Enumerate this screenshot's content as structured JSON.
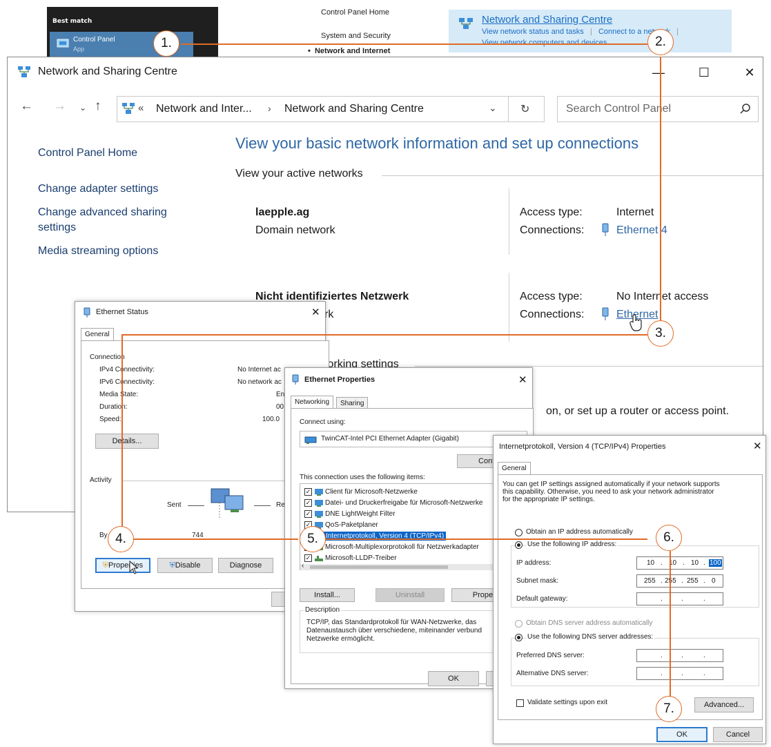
{
  "start_menu": {
    "best_match": "Best match",
    "item_label": "Control Panel",
    "item_sub": "App"
  },
  "cp_top": {
    "home": "Control Panel Home",
    "system": "System and Security",
    "network": "Network and Internet"
  },
  "nsc_top": {
    "title": "Network and Sharing Centre",
    "link1": "View network status and tasks",
    "link2": "Connect to a network",
    "link3": "View network computers and devices"
  },
  "main_window": {
    "title": "Network and Sharing Centre",
    "controls": {
      "minimize": "—",
      "maximize": "☐",
      "close": "✕"
    },
    "address": {
      "part1": "Network and Inter...",
      "separator": "›",
      "part2": "Network and Sharing Centre"
    },
    "search_placeholder": "Search Control Panel",
    "left_nav": [
      "Control Panel Home",
      "Change adapter settings",
      "Change advanced sharing",
      "settings",
      "Media streaming options"
    ],
    "headline": "View your basic network information and set up connections",
    "active_networks": "View your active networks",
    "network1": {
      "name": "laepple.ag",
      "type": "Domain network",
      "access_label": "Access type:",
      "access_value": "Internet",
      "conn_label": "Connections:",
      "conn_value": "Ethernet 4"
    },
    "network2": {
      "name": "Nicht identifiziertes Netzwerk",
      "type_partial": "rk",
      "access_label": "Access type:",
      "access_value": "No Internet access",
      "conn_label": "Connections:",
      "conn_value": "Ethernet"
    },
    "change_partial": "working settings",
    "router_partial": "on, or set up a router or access point."
  },
  "ethernet_status": {
    "title": "Ethernet Status",
    "tab": "General",
    "connection_group": "Connection",
    "rows": [
      {
        "label": "IPv4 Connectivity:",
        "value": "No Internet ac"
      },
      {
        "label": "IPv6 Connectivity:",
        "value": "No network ac"
      },
      {
        "label": "Media State:",
        "value": "En"
      },
      {
        "label": "Duration:",
        "value": "00:"
      },
      {
        "label": "Speed:",
        "value": "100.0"
      }
    ],
    "details_button": "Details...",
    "activity_group": "Activity",
    "sent": "Sent",
    "received_partial": "Rece",
    "bytes_partial": "By",
    "bytes_sent": "744",
    "properties_button": "Properties",
    "disable_button": "Disable",
    "diagnose_button": "Diagnose"
  },
  "ethernet_properties": {
    "title": "Ethernet Properties",
    "tabs": [
      "Networking",
      "Sharing"
    ],
    "connect_using": "Connect using:",
    "adapter": "TwinCAT-Intel PCI Ethernet Adapter (Gigabit)",
    "configure_button": "Configu",
    "items_label": "This connection uses the following items:",
    "items": [
      {
        "label": "Client für Microsoft-Netzwerke",
        "checked": true
      },
      {
        "label": "Datei- und Druckerfreigabe für Microsoft-Netzwerke",
        "checked": true
      },
      {
        "label": "DNE LightWeight Filter",
        "checked": true
      },
      {
        "label": "QoS-Paketplaner",
        "checked": true
      },
      {
        "label": "Internetprotokoll, Version 4 (TCP/IPv4)",
        "checked": true
      },
      {
        "label": "Microsoft-Multiplexorprotokoll für Netzwerkadapter",
        "checked": false
      },
      {
        "label": "Microsoft-LLDP-Treiber",
        "checked": true
      }
    ],
    "install_button": "Install...",
    "uninstall_button": "Uninstall",
    "properties_button": "Properti",
    "description_group": "Description",
    "description": [
      "TCP/IP, das Standardprotokoll für WAN-Netzwerke, das",
      "Datenaustausch über verschiedene, miteinander verbund",
      "Netzwerke ermöglicht."
    ],
    "ok_button": "OK"
  },
  "ipv4_properties": {
    "title": "Internetprotokoll, Version 4 (TCP/IPv4) Properties",
    "tab": "General",
    "intro": [
      "You can get IP settings assigned automatically if your network supports",
      "this capability. Otherwise, you need to ask your network administrator",
      "for the appropriate IP settings."
    ],
    "auto_ip": "Obtain an IP address automatically",
    "use_ip": "Use the following IP address:",
    "ip_label": "IP address:",
    "ip_value": [
      "10",
      "10",
      "10",
      "100"
    ],
    "subnet_label": "Subnet mask:",
    "subnet_value": [
      "255",
      "255",
      "255",
      "0"
    ],
    "gateway_label": "Default gateway:",
    "auto_dns": "Obtain DNS server address automatically",
    "use_dns": "Use the following DNS server addresses:",
    "pref_dns": "Preferred DNS server:",
    "alt_dns": "Alternative DNS server:",
    "validate": "Validate settings upon exit",
    "advanced_button": "Advanced...",
    "ok_button": "OK",
    "cancel_button": "Cancel"
  },
  "steps": [
    "1.",
    "2.",
    "3.",
    "4.",
    "5.",
    "6.",
    "7."
  ],
  "colors": {
    "accent_line": "#e06b25",
    "link": "#2e67a6",
    "selection": "#0a64c8"
  }
}
